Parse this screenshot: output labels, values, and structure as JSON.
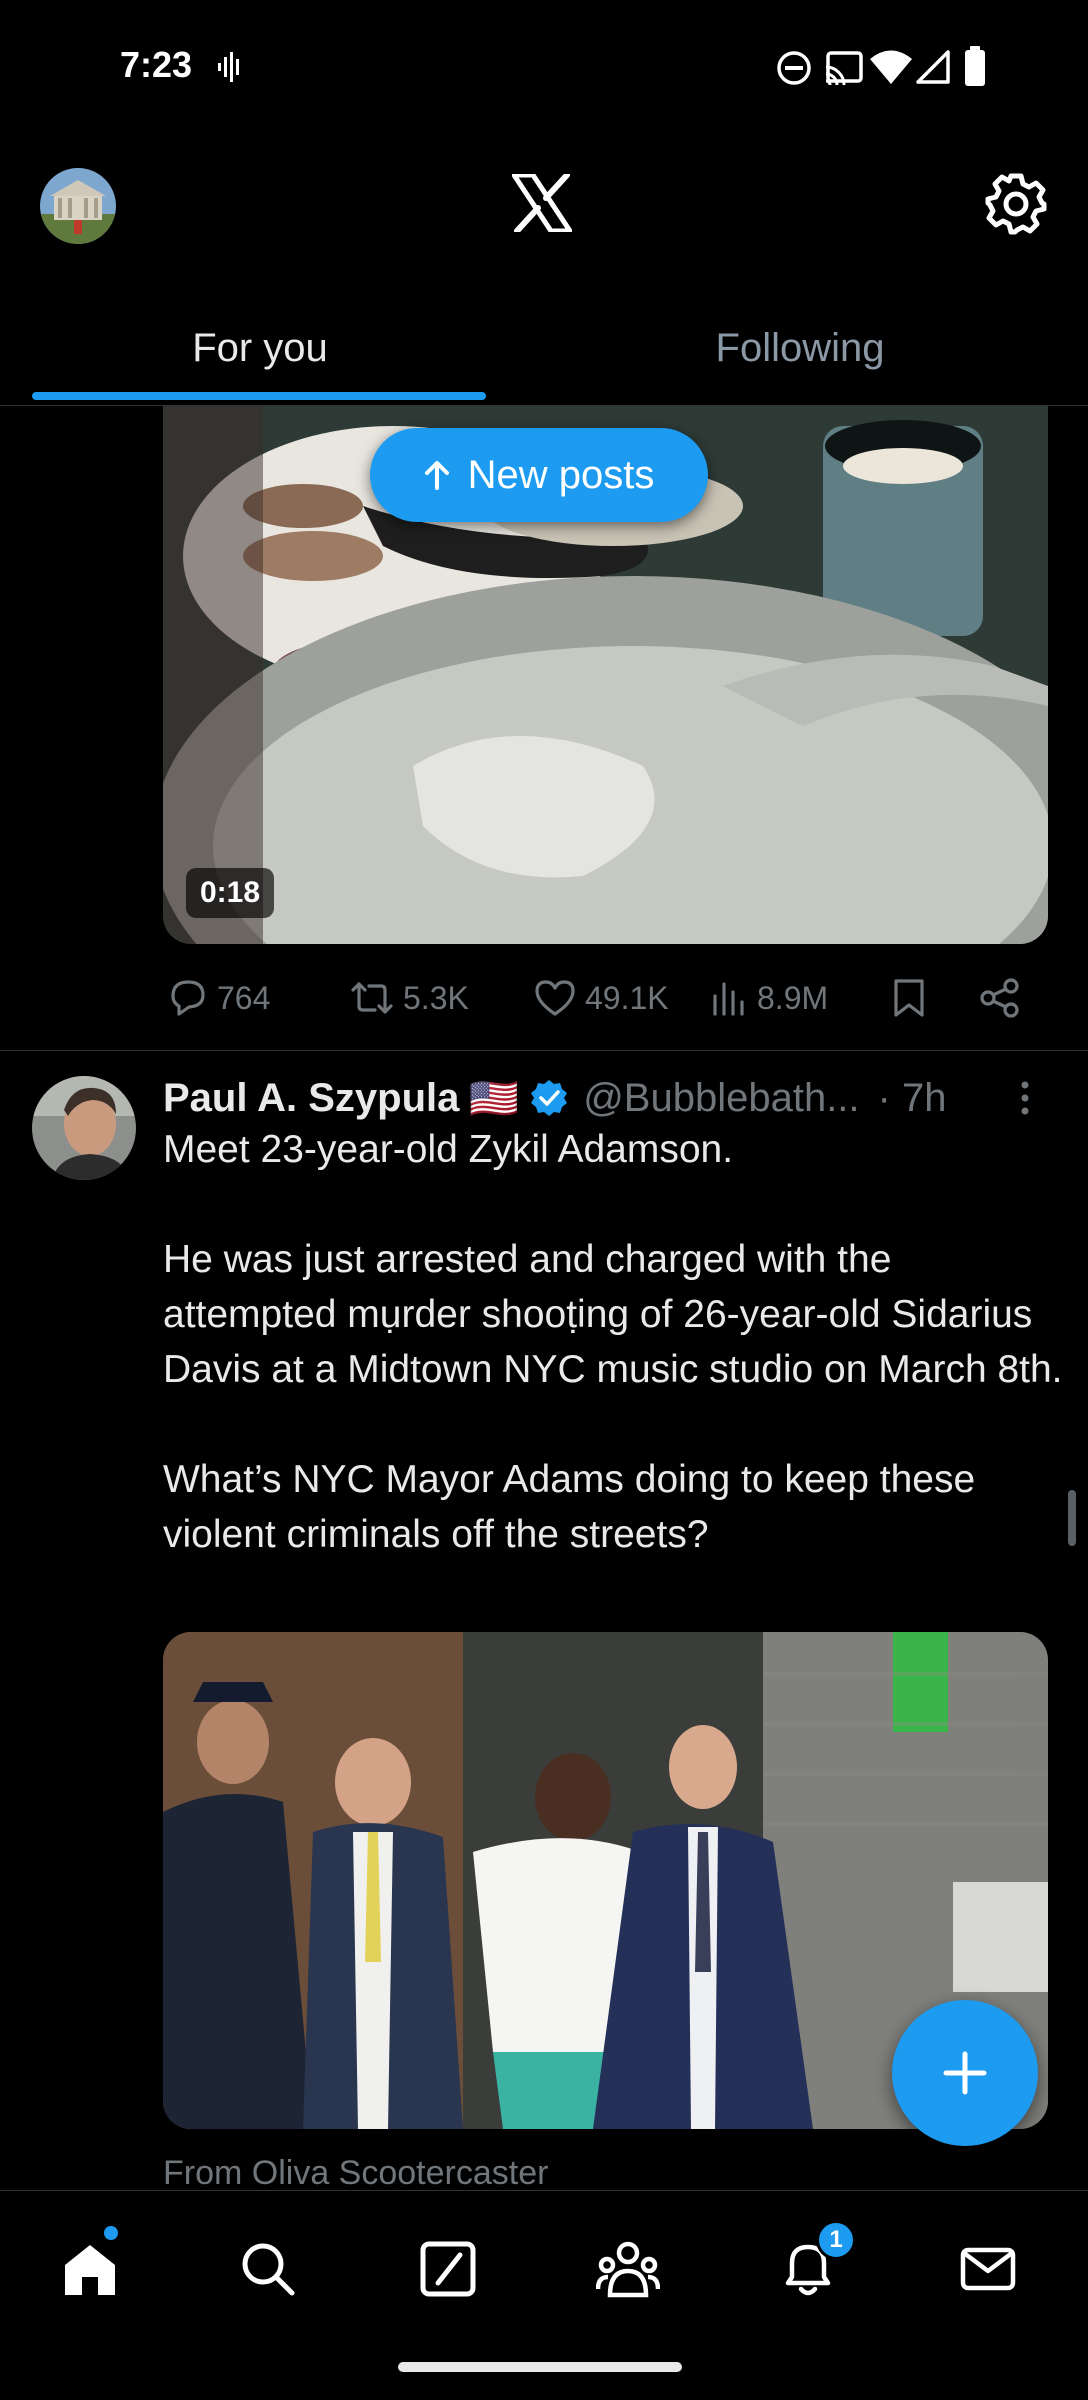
{
  "status_bar": {
    "time": "7:23"
  },
  "header": {
    "logo": "X"
  },
  "tabs": [
    {
      "label": "For you",
      "active": true
    },
    {
      "label": "Following",
      "active": false
    }
  ],
  "new_posts_pill": {
    "label": "New posts"
  },
  "post1": {
    "video_duration": "0:18",
    "stats": {
      "replies": "764",
      "reposts": "5.3K",
      "likes": "49.1K",
      "views": "8.9M"
    }
  },
  "post2": {
    "author_name": "Paul A. Szypula",
    "flag": "🇺🇸",
    "handle": "@Bubblebath...",
    "time": "· 7h",
    "text": "Meet 23-year-old Zykil Adamson.\n\nHe was just arrested and charged with the attempted mụrder shooṭing of 26-year-old Sidarius Davis at a Midtown NYC music studio on March 8th.\n\nWhat’s NYC Mayor Adams doing to keep these violent criminals off the streets?",
    "from_line": "From Oliva Scootercaster"
  },
  "bottom_nav": {
    "items": [
      "home-icon",
      "search-icon",
      "grok-icon",
      "communities-icon",
      "notifications-icon",
      "messages-icon"
    ],
    "notifications_badge": "1"
  },
  "colors": {
    "accent": "#1d9bf0",
    "background": "#000000",
    "secondary_text": "#71767b"
  }
}
